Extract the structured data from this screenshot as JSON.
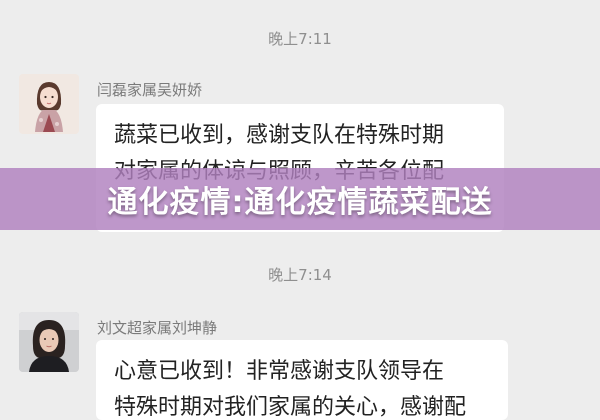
{
  "chat": {
    "messages": [
      {
        "time": "晚上7:11",
        "sender": "闫磊家属吴妍娇",
        "lines": [
          "蔬菜已收到，感谢支队在特殊时期",
          "对家属的体谅与照顾，辛苦各位配"
        ],
        "avatar_icon": "illustrated-woman-avatar"
      },
      {
        "time": "晚上7:14",
        "sender": "刘文超家属刘坤静",
        "lines": [
          "心意已收到！非常感谢支队领导在",
          "特殊时期对我们家属的关心，感谢配"
        ],
        "avatar_icon": "woman-photo-avatar"
      }
    ]
  },
  "banner": {
    "title": "通化疫情:通化疫情蔬菜配送",
    "color": "#b080be"
  }
}
